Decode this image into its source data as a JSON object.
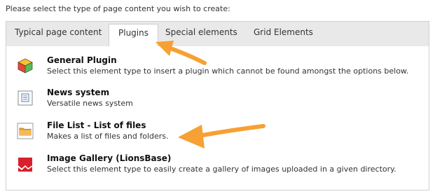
{
  "prompt": "Please select the type of page content you wish to create:",
  "tabs": [
    {
      "label": "Typical page content"
    },
    {
      "label": "Plugins",
      "active": true
    },
    {
      "label": "Special elements"
    },
    {
      "label": "Grid Elements"
    }
  ],
  "items": [
    {
      "title": "General Plugin",
      "description": "Select this element type to insert a plugin which cannot be found amongst the options below.",
      "icon": "cube-icon"
    },
    {
      "title": "News system",
      "description": "Versatile news system",
      "icon": "news-document-icon"
    },
    {
      "title": "File List - List of files",
      "description": "Makes a list of files and folders.",
      "icon": "folder-icon"
    },
    {
      "title": "Image Gallery (LionsBase)",
      "description": "Select this element type to easily create a gallery of images uploaded in a given directory.",
      "icon": "image-gallery-icon"
    }
  ],
  "colors": {
    "annotation_arrow": "#f7a033",
    "tab_bar": "#e9e9e9",
    "border": "#cfcfcf"
  }
}
